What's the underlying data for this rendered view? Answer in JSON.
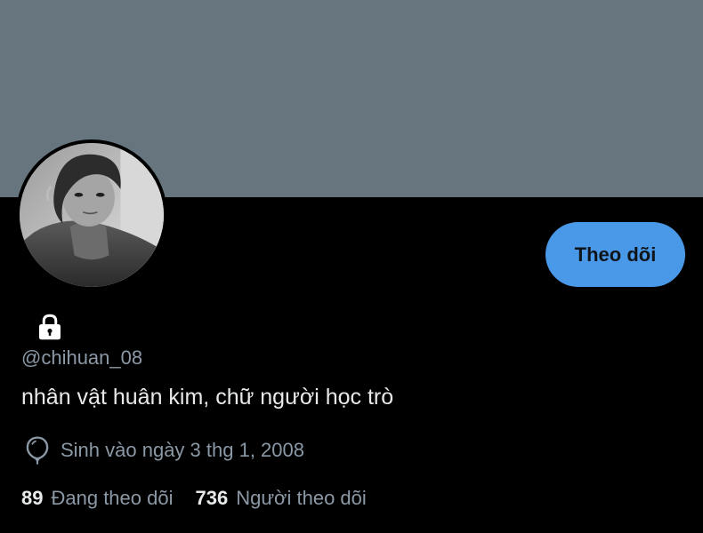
{
  "profile": {
    "handle": "@chihuan_08",
    "bio": "nhân vật huân kim, chữ người học trò",
    "birth": "Sinh vào ngày 3 thg 1, 2008",
    "follow_label": "Theo dõi",
    "following_count": "89",
    "following_label": "Đang theo dõi",
    "followers_count": "736",
    "followers_label": "Người theo dõi",
    "protected": true
  },
  "icons": {
    "lock": "lock-icon",
    "birthday": "balloon-icon"
  },
  "colors": {
    "banner": "#67757f",
    "background": "#000000",
    "accent": "#4a99e9",
    "secondary_text": "#8b98a5",
    "primary_text": "#e7e9ea"
  }
}
